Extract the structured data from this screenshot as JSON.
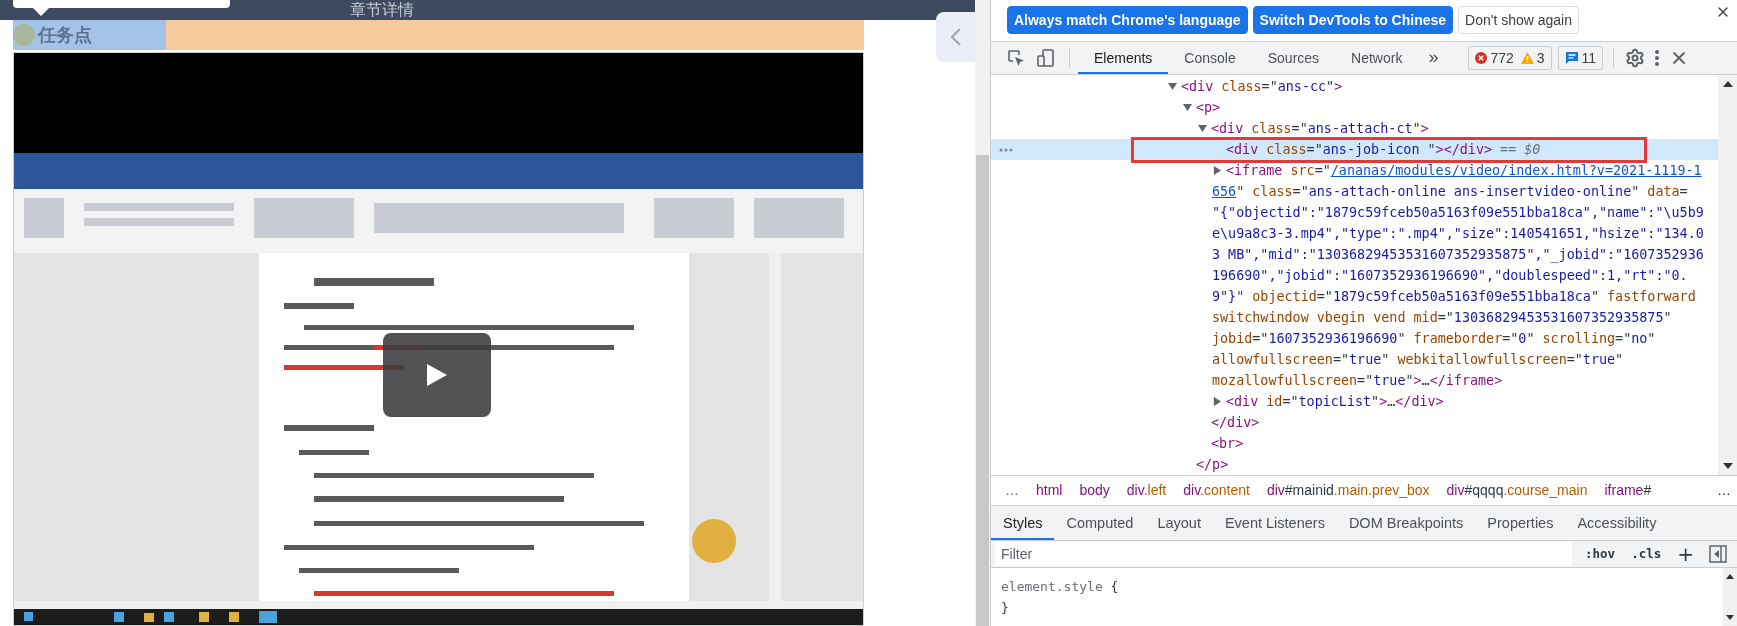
{
  "page": {
    "title": "章节详情",
    "task_label": "任务点"
  },
  "devtools": {
    "language_buttons": [
      {
        "label": "Always match Chrome's language",
        "kind": "primary"
      },
      {
        "label": "Switch DevTools to Chinese",
        "kind": "primary"
      },
      {
        "label": "Don't show again",
        "kind": "secondary"
      }
    ],
    "tabs": [
      {
        "label": "Elements",
        "selected": true
      },
      {
        "label": "Console",
        "selected": false
      },
      {
        "label": "Sources",
        "selected": false
      },
      {
        "label": "Network",
        "selected": false
      }
    ],
    "more_tabs": "»",
    "errors": "772",
    "warnings": "3",
    "messages": "11",
    "dom_tree": [
      {
        "lines": [
          [
            {
              "kind": "tag",
              "text": "<div"
            },
            {
              "kind": "attr",
              "text": " class"
            },
            {
              "kind": "plain",
              "text": "=\""
            },
            {
              "kind": "value",
              "text": "ans-cc"
            },
            {
              "kind": "plain",
              "text": "\""
            },
            {
              "kind": "tag",
              "text": ">"
            }
          ]
        ],
        "expanded": true,
        "selected": false,
        "children": [
          {
            "lines": [
              [
                {
                  "kind": "tag",
                  "text": "<p>"
                }
              ]
            ],
            "expanded": true,
            "selected": false,
            "close": [
              {
                "kind": "tag",
                "text": "</p>"
              }
            ],
            "children": [
              {
                "lines": [
                  [
                    {
                      "kind": "tag",
                      "text": "<div"
                    },
                    {
                      "kind": "attr",
                      "text": " class"
                    },
                    {
                      "kind": "plain",
                      "text": "=\""
                    },
                    {
                      "kind": "value",
                      "text": "ans-attach-ct"
                    },
                    {
                      "kind": "plain",
                      "text": "\""
                    },
                    {
                      "kind": "tag",
                      "text": ">"
                    }
                  ]
                ],
                "expanded": true,
                "selected": false,
                "close": [
                  {
                    "kind": "tag",
                    "text": "</div>"
                  }
                ],
                "children": [
                  {
                    "lines": [
                      [
                        {
                          "kind": "tag",
                          "text": "<div"
                        },
                        {
                          "kind": "attr",
                          "text": " class"
                        },
                        {
                          "kind": "plain",
                          "text": "=\""
                        },
                        {
                          "kind": "value",
                          "text": "ans-job-icon "
                        },
                        {
                          "kind": "plain",
                          "text": "\""
                        },
                        {
                          "kind": "tag",
                          "text": "></div>"
                        },
                        {
                          "kind": "dollar",
                          "text": " == $0"
                        }
                      ]
                    ],
                    "selected": true
                  },
                  {
                    "lines": [
                      [
                        {
                          "kind": "tag",
                          "text": "<iframe"
                        },
                        {
                          "kind": "attr",
                          "text": " src"
                        },
                        {
                          "kind": "plain",
                          "text": "=\""
                        },
                        {
                          "kind": "link",
                          "text": "/ananas/modules/video/index.html?v=2021-1119-1"
                        }
                      ],
                      [
                        {
                          "kind": "link",
                          "text": "656"
                        },
                        {
                          "kind": "plain",
                          "text": "\" "
                        },
                        {
                          "kind": "attr",
                          "text": "class"
                        },
                        {
                          "kind": "plain",
                          "text": "=\""
                        },
                        {
                          "kind": "value",
                          "text": "ans-attach-online ans-insertvideo-online"
                        },
                        {
                          "kind": "plain",
                          "text": "\" "
                        },
                        {
                          "kind": "attr",
                          "text": "data"
                        },
                        {
                          "kind": "plain",
                          "text": "="
                        }
                      ],
                      [
                        {
                          "kind": "plain",
                          "text": "\""
                        },
                        {
                          "kind": "value",
                          "text": "{\"objectid\":\"1879c59fceb50a5163f09e551bba18ca\",\"name\":\"\\u5b9"
                        }
                      ],
                      [
                        {
                          "kind": "value",
                          "text": "e\\u9a8c3-3.mp4\",\"type\":\".mp4\",\"size\":140541651,\"hsize\":\"134.0"
                        }
                      ],
                      [
                        {
                          "kind": "value",
                          "text": "3 MB\",\"mid\":\"13036829453531607352935875\",\"_jobid\":\"1607352936"
                        }
                      ],
                      [
                        {
                          "kind": "value",
                          "text": "196690\",\"jobid\":\"1607352936196690\",\"doublespeed\":1,\"rt\":\"0."
                        }
                      ],
                      [
                        {
                          "kind": "value",
                          "text": "9\"}"
                        },
                        {
                          "kind": "plain",
                          "text": "\" "
                        },
                        {
                          "kind": "attr",
                          "text": "objectid"
                        },
                        {
                          "kind": "plain",
                          "text": "=\""
                        },
                        {
                          "kind": "value",
                          "text": "1879c59fceb50a5163f09e551bba18ca"
                        },
                        {
                          "kind": "plain",
                          "text": "\" "
                        },
                        {
                          "kind": "attr",
                          "text": "fastforward"
                        }
                      ],
                      [
                        {
                          "kind": "attr",
                          "text": "switchwindow vbegin vend mid"
                        },
                        {
                          "kind": "plain",
                          "text": "=\""
                        },
                        {
                          "kind": "value",
                          "text": "13036829453531607352935875"
                        },
                        {
                          "kind": "plain",
                          "text": "\""
                        }
                      ],
                      [
                        {
                          "kind": "attr",
                          "text": "jobid"
                        },
                        {
                          "kind": "plain",
                          "text": "=\""
                        },
                        {
                          "kind": "value",
                          "text": "1607352936196690"
                        },
                        {
                          "kind": "plain",
                          "text": "\" "
                        },
                        {
                          "kind": "attr",
                          "text": "frameborder"
                        },
                        {
                          "kind": "plain",
                          "text": "=\""
                        },
                        {
                          "kind": "value",
                          "text": "0"
                        },
                        {
                          "kind": "plain",
                          "text": "\" "
                        },
                        {
                          "kind": "attr",
                          "text": "scrolling"
                        },
                        {
                          "kind": "plain",
                          "text": "=\""
                        },
                        {
                          "kind": "value",
                          "text": "no"
                        },
                        {
                          "kind": "plain",
                          "text": "\""
                        }
                      ],
                      [
                        {
                          "kind": "attr",
                          "text": "allowfullscreen"
                        },
                        {
                          "kind": "plain",
                          "text": "=\""
                        },
                        {
                          "kind": "value",
                          "text": "true"
                        },
                        {
                          "kind": "plain",
                          "text": "\" "
                        },
                        {
                          "kind": "attr",
                          "text": "webkitallowfullscreen"
                        },
                        {
                          "kind": "plain",
                          "text": "=\""
                        },
                        {
                          "kind": "value",
                          "text": "true"
                        },
                        {
                          "kind": "plain",
                          "text": "\""
                        }
                      ],
                      [
                        {
                          "kind": "attr",
                          "text": "mozallowfullscreen"
                        },
                        {
                          "kind": "plain",
                          "text": "=\""
                        },
                        {
                          "kind": "value",
                          "text": "true"
                        },
                        {
                          "kind": "plain",
                          "text": "\""
                        },
                        {
                          "kind": "tag",
                          "text": ">"
                        },
                        {
                          "kind": "plain",
                          "text": "…"
                        },
                        {
                          "kind": "tag",
                          "text": "</iframe>"
                        }
                      ]
                    ],
                    "expanded": false,
                    "selected": false
                  },
                  {
                    "lines": [
                      [
                        {
                          "kind": "tag",
                          "text": "<div"
                        },
                        {
                          "kind": "attr",
                          "text": " id"
                        },
                        {
                          "kind": "plain",
                          "text": "=\""
                        },
                        {
                          "kind": "value",
                          "text": "topicList"
                        },
                        {
                          "kind": "plain",
                          "text": "\""
                        },
                        {
                          "kind": "tag",
                          "text": ">"
                        },
                        {
                          "kind": "plain",
                          "text": "…"
                        },
                        {
                          "kind": "tag",
                          "text": "</div>"
                        }
                      ]
                    ],
                    "expanded": false,
                    "selected": false
                  }
                ]
              },
              {
                "lines": [
                  [
                    {
                      "kind": "tag",
                      "text": "<br>"
                    }
                  ]
                ],
                "selected": false
              }
            ]
          }
        ]
      }
    ],
    "breadcrumbs": {
      "lead": "…",
      "items": [
        [
          {
            "kind": "tag",
            "text": "html"
          }
        ],
        [
          {
            "kind": "tag",
            "text": "body"
          }
        ],
        [
          {
            "kind": "tag",
            "text": "div"
          },
          {
            "kind": "cls",
            "text": ".left"
          }
        ],
        [
          {
            "kind": "tag",
            "text": "div"
          },
          {
            "kind": "cls",
            "text": ".content"
          }
        ],
        [
          {
            "kind": "tag",
            "text": "div"
          },
          {
            "kind": "id",
            "text": "#mainid"
          },
          {
            "kind": "cls",
            "text": ".main.prev_box"
          }
        ],
        [
          {
            "kind": "tag",
            "text": "div"
          },
          {
            "kind": "id",
            "text": "#qqqq"
          },
          {
            "kind": "cls",
            "text": ".course_main"
          }
        ],
        [
          {
            "kind": "tag",
            "text": "iframe"
          },
          {
            "kind": "id",
            "text": "#"
          }
        ]
      ],
      "trail": "…"
    },
    "styles_tabs": [
      {
        "label": "Styles",
        "selected": true
      },
      {
        "label": "Computed",
        "selected": false
      },
      {
        "label": "Layout",
        "selected": false
      },
      {
        "label": "Event Listeners",
        "selected": false
      },
      {
        "label": "DOM Breakpoints",
        "selected": false
      },
      {
        "label": "Properties",
        "selected": false
      },
      {
        "label": "Accessibility",
        "selected": false
      }
    ],
    "filter": {
      "placeholder": "Filter"
    },
    "filter_buttons": [
      {
        "label": ":hov",
        "kind": "toggle"
      },
      {
        "label": ".cls",
        "kind": "toggle"
      },
      {
        "label": "+",
        "kind": "add"
      }
    ],
    "rules": [
      [
        {
          "kind": "sel",
          "text": "element.style"
        },
        {
          "kind": "plain",
          "text": " {"
        }
      ],
      [
        {
          "kind": "plain",
          "text": "}"
        }
      ]
    ]
  }
}
